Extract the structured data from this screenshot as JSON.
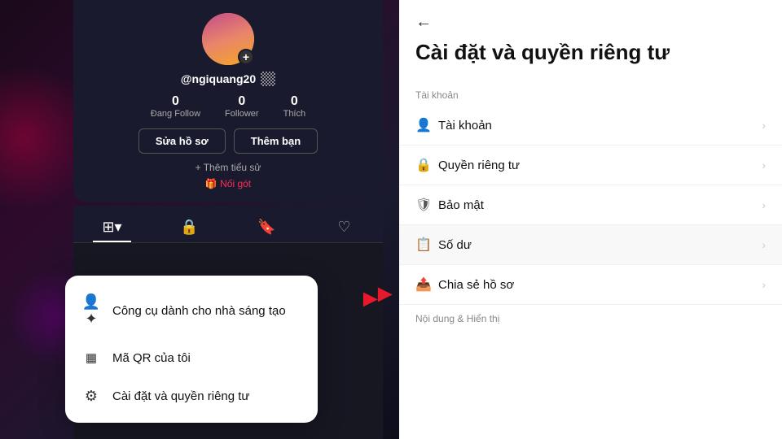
{
  "background": {
    "accentColor": "#e8192c"
  },
  "leftPanel": {
    "profile": {
      "username": "@ngiquang20",
      "stats": [
        {
          "number": "0",
          "label": "Đang Follow"
        },
        {
          "number": "0",
          "label": "Follower"
        },
        {
          "number": "0",
          "label": "Thích"
        }
      ],
      "buttons": {
        "editProfile": "Sửa hồ sơ",
        "addFriend": "Thêm bạn"
      },
      "bioLink": "+ Thêm tiểu sử",
      "noigot": "🎁 Nối gót"
    }
  },
  "popupMenu": {
    "items": [
      {
        "icon": "👤✨",
        "label": "Công cụ dành cho nhà sáng tạo"
      },
      {
        "icon": "▦",
        "label": "Mã QR của tôi"
      },
      {
        "icon": "⚙",
        "label": "Cài đặt và quyền riêng tư"
      }
    ]
  },
  "rightPanel": {
    "backArrow": "←",
    "title": "Cài đặt và quyền riêng tư",
    "sections": [
      {
        "label": "Tài khoản",
        "items": [
          {
            "icon": "👤",
            "label": "Tài khoản"
          },
          {
            "icon": "🔒",
            "label": "Quyền riêng tư"
          },
          {
            "icon": "🛡",
            "label": "Bảo mật"
          },
          {
            "icon": "📋",
            "label": "Số dư",
            "highlighted": true
          },
          {
            "icon": "📤",
            "label": "Chia sẻ hồ sơ"
          }
        ]
      },
      {
        "label": "Nội dung & Hiển thị",
        "items": []
      }
    ]
  }
}
